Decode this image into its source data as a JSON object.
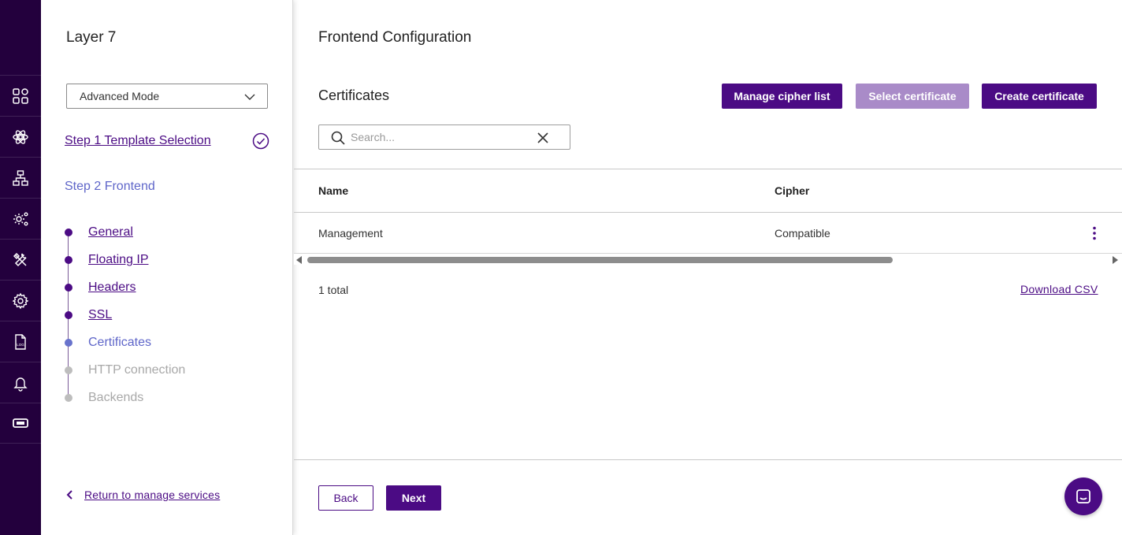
{
  "rail": {
    "items": [
      {
        "icon": "grid-icon"
      },
      {
        "icon": "atom-icon"
      },
      {
        "icon": "network-icon"
      },
      {
        "icon": "gear-cluster-icon"
      },
      {
        "icon": "tools-icon"
      },
      {
        "icon": "settings-gear-icon"
      },
      {
        "icon": "log-file-icon"
      },
      {
        "icon": "bell-icon"
      },
      {
        "icon": "ticket-icon"
      }
    ],
    "log_label": "LOG"
  },
  "wizard": {
    "title": "Layer 7",
    "mode": {
      "selected": "Advanced Mode"
    },
    "step1_label": "Step 1 Template Selection",
    "step2_label": "Step 2 Frontend",
    "substeps": [
      {
        "label": "General",
        "state": "done"
      },
      {
        "label": "Floating IP",
        "state": "done"
      },
      {
        "label": "Headers",
        "state": "done"
      },
      {
        "label": "SSL",
        "state": "done"
      },
      {
        "label": "Certificates",
        "state": "current"
      },
      {
        "label": "HTTP connection",
        "state": "todo"
      },
      {
        "label": "Backends",
        "state": "todo"
      }
    ],
    "return_label": "Return to manage services"
  },
  "main": {
    "page_title": "Frontend Configuration",
    "section_title": "Certificates",
    "buttons": {
      "manage_cipher": "Manage cipher list",
      "select_cert": "Select certificate",
      "create_cert": "Create certificate"
    },
    "search": {
      "placeholder": "Search...",
      "value": ""
    },
    "table": {
      "columns": [
        "Name",
        "Cipher"
      ],
      "rows": [
        {
          "name": "Management",
          "cipher": "Compatible"
        }
      ]
    },
    "total_text": "1 total",
    "download_csv": "Download CSV",
    "footer": {
      "back": "Back",
      "next": "Next"
    }
  },
  "colors": {
    "rail_bg": "#23003d",
    "primary": "#4b0b84",
    "primary_disabled": "#a98bc8",
    "current_step": "#5f66c9"
  }
}
